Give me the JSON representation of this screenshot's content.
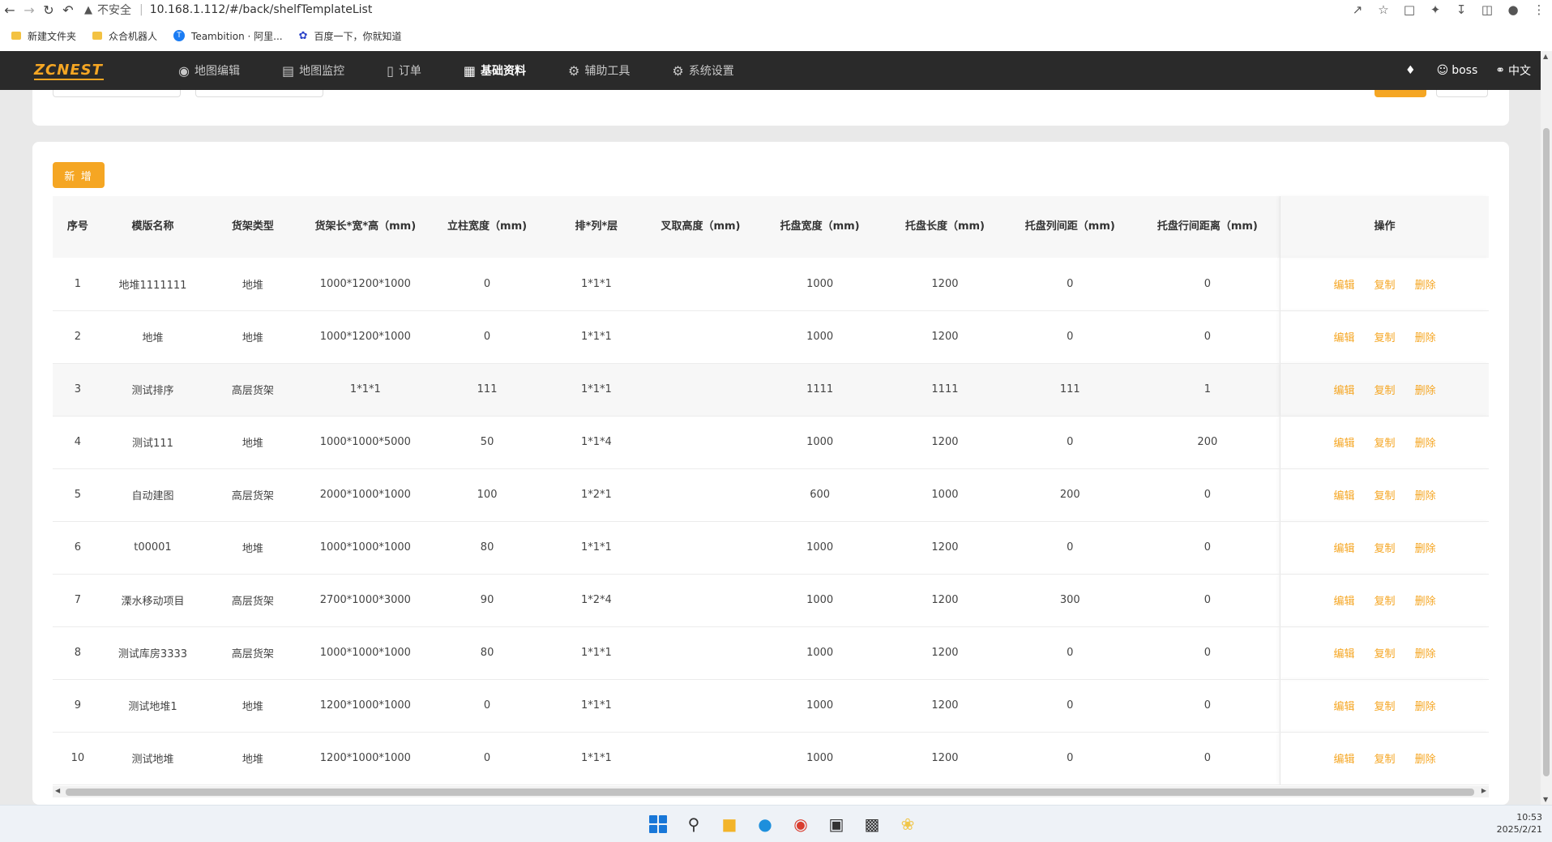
{
  "browser": {
    "security_text": "不安全",
    "url": "10.168.1.112/#/back/shelfTemplateList",
    "bookmarks": [
      "新建文件夹",
      "众合机器人",
      "Teambition · 阿里...",
      "百度一下，你就知道"
    ]
  },
  "header": {
    "logo": "ZCNEST",
    "menu": [
      {
        "label": "地图编辑",
        "icon": "map-pin-icon"
      },
      {
        "label": "地图监控",
        "icon": "chart-line-icon"
      },
      {
        "label": "订单",
        "icon": "document-icon"
      },
      {
        "label": "基础资料",
        "icon": "sliders-icon",
        "active": true
      },
      {
        "label": "辅助工具",
        "icon": "gear-icon"
      },
      {
        "label": "系统设置",
        "icon": "gear-icon"
      }
    ],
    "user": "boss",
    "language": "中文"
  },
  "toolbar": {
    "add_label": "新 增"
  },
  "table": {
    "columns": [
      "序号",
      "模版名称",
      "货架类型",
      "货架长*宽*高（mm)",
      "立柱宽度（mm)",
      "排*列*层",
      "叉取高度（mm)",
      "托盘宽度（mm)",
      "托盘长度（mm)",
      "托盘列间距（mm)",
      "托盘行间距离（mm)",
      "操作"
    ],
    "actions": [
      "编辑",
      "复制",
      "删除"
    ],
    "rows": [
      [
        "1",
        "地堆1111111",
        "地堆",
        "1000*1200*1000",
        "0",
        "1*1*1",
        "",
        "1000",
        "1200",
        "0",
        "0"
      ],
      [
        "2",
        "地堆",
        "地堆",
        "1000*1200*1000",
        "0",
        "1*1*1",
        "",
        "1000",
        "1200",
        "0",
        "0"
      ],
      [
        "3",
        "测试排序",
        "高层货架",
        "1*1*1",
        "111",
        "1*1*1",
        "",
        "1111",
        "1111",
        "111",
        "1"
      ],
      [
        "4",
        "测试111",
        "地堆",
        "1000*1000*5000",
        "50",
        "1*1*4",
        "",
        "1000",
        "1200",
        "0",
        "200"
      ],
      [
        "5",
        "自动建图",
        "高层货架",
        "2000*1000*1000",
        "100",
        "1*2*1",
        "",
        "600",
        "1000",
        "200",
        "0"
      ],
      [
        "6",
        "t00001",
        "地堆",
        "1000*1000*1000",
        "80",
        "1*1*1",
        "",
        "1000",
        "1200",
        "0",
        "0"
      ],
      [
        "7",
        "溧水移动项目",
        "高层货架",
        "2700*1000*3000",
        "90",
        "1*2*4",
        "",
        "1000",
        "1200",
        "300",
        "0"
      ],
      [
        "8",
        "测试库房3333",
        "高层货架",
        "1000*1000*1000",
        "80",
        "1*1*1",
        "",
        "1000",
        "1200",
        "0",
        "0"
      ],
      [
        "9",
        "测试地堆1",
        "地堆",
        "1200*1000*1000",
        "0",
        "1*1*1",
        "",
        "1000",
        "1200",
        "0",
        "0"
      ],
      [
        "10",
        "测试地堆",
        "地堆",
        "1200*1000*1000",
        "0",
        "1*1*1",
        "",
        "1000",
        "1200",
        "0",
        "0"
      ]
    ]
  },
  "taskbar": {
    "time": "10:53",
    "date": "2025/2/21"
  },
  "colors": {
    "accent": "#f5a623",
    "header_bg": "#2a2a2a"
  }
}
